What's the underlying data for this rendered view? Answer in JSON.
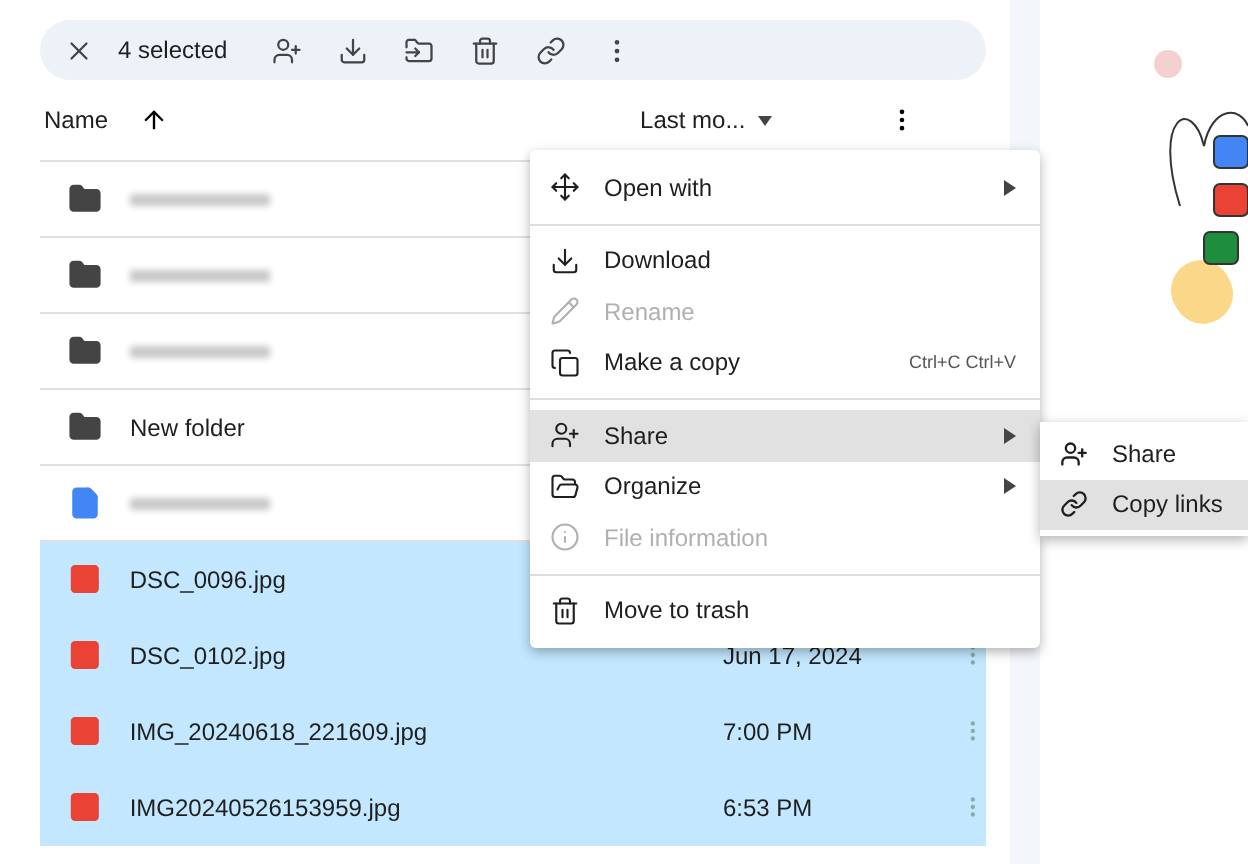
{
  "toolbar": {
    "selection_count": "4 selected"
  },
  "header": {
    "name": "Name",
    "modified": "Last mo..."
  },
  "rows": [
    {
      "kind": "folder",
      "name": null,
      "date": null,
      "selected": false
    },
    {
      "kind": "folder",
      "name": null,
      "date": null,
      "selected": false
    },
    {
      "kind": "folder",
      "name": null,
      "date": null,
      "selected": false
    },
    {
      "kind": "folder",
      "name": "New folder",
      "date": null,
      "selected": false
    },
    {
      "kind": "doc",
      "name": null,
      "date": null,
      "selected": false
    },
    {
      "kind": "image",
      "name": "DSC_0096.jpg",
      "date": null,
      "selected": true
    },
    {
      "kind": "image",
      "name": "DSC_0102.jpg",
      "date": "Jun 17, 2024",
      "selected": true
    },
    {
      "kind": "image",
      "name": "IMG_20240618_221609.jpg",
      "date": "7:00 PM",
      "selected": true
    },
    {
      "kind": "image",
      "name": "IMG20240526153959.jpg",
      "date": "6:53 PM",
      "selected": true
    }
  ],
  "context_menu": [
    {
      "kind": "item",
      "label": "Open with",
      "submenu": true,
      "disabled": false,
      "selected": false
    },
    {
      "kind": "divider"
    },
    {
      "kind": "item",
      "label": "Download",
      "submenu": false,
      "disabled": false,
      "selected": false
    },
    {
      "kind": "item",
      "label": "Rename",
      "submenu": false,
      "disabled": true,
      "selected": false
    },
    {
      "kind": "item",
      "label": "Make a copy",
      "shortcut": "Ctrl+C Ctrl+V",
      "submenu": false,
      "disabled": false,
      "selected": false
    },
    {
      "kind": "divider"
    },
    {
      "kind": "item",
      "label": "Share",
      "submenu": true,
      "disabled": false,
      "selected": true
    },
    {
      "kind": "item",
      "label": "Organize",
      "submenu": true,
      "disabled": false,
      "selected": false
    },
    {
      "kind": "item",
      "label": "File information",
      "submenu": false,
      "disabled": true,
      "selected": false
    },
    {
      "kind": "divider"
    },
    {
      "kind": "item",
      "label": "Move to trash",
      "submenu": false,
      "disabled": false,
      "selected": false
    }
  ],
  "share_submenu": [
    {
      "label": "Share",
      "selected": false
    },
    {
      "label": "Copy links",
      "selected": true
    }
  ]
}
